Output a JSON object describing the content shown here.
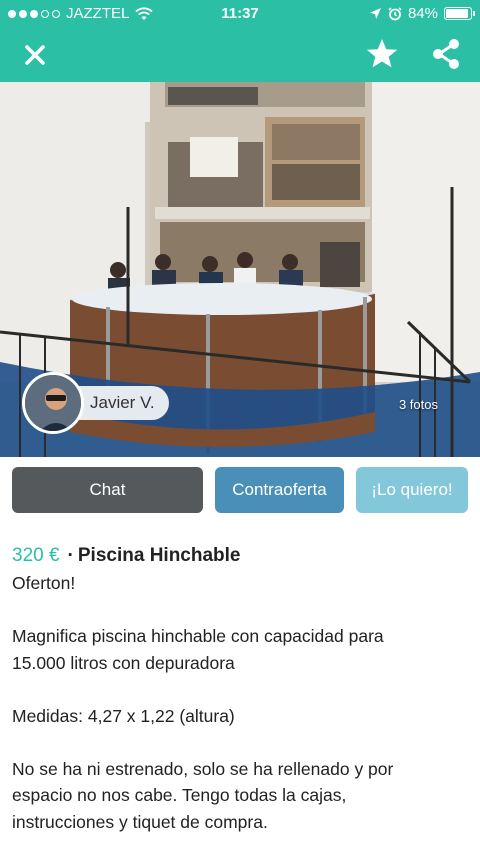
{
  "status_bar": {
    "carrier": "JAZZTEL",
    "time": "11:37",
    "battery": "84%",
    "battery_level": 0.84,
    "signal_bars": 3
  },
  "header": {
    "close_icon": "close-icon",
    "favorite_icon": "star-icon",
    "share_icon": "share-icon",
    "accent_color": "#2bbfa5"
  },
  "gallery": {
    "seller_name": "Javier V.",
    "photo_count": "3 fotos"
  },
  "actions": {
    "chat_label": "Chat",
    "counteroffer_label": "Contraoferta",
    "want_label": "¡Lo quiero!"
  },
  "listing": {
    "price": "320 €",
    "separator": "·",
    "title": "Piscina Hinchable",
    "subtitle": "Oferton!",
    "description_1_line_1": "Magnifica piscina hinchable con capacidad para",
    "description_1_line_2": "15.000 litros con depuradora",
    "description_2": "Medidas: 4,27 x 1,22 (altura)",
    "description_3_line_1": "No se ha ni estrenado, solo se ha rellenado y por",
    "description_3_line_2": "espacio no nos cabe. Tengo todas la cajas,",
    "description_3_line_3": "instrucciones y tiquet de compra."
  }
}
